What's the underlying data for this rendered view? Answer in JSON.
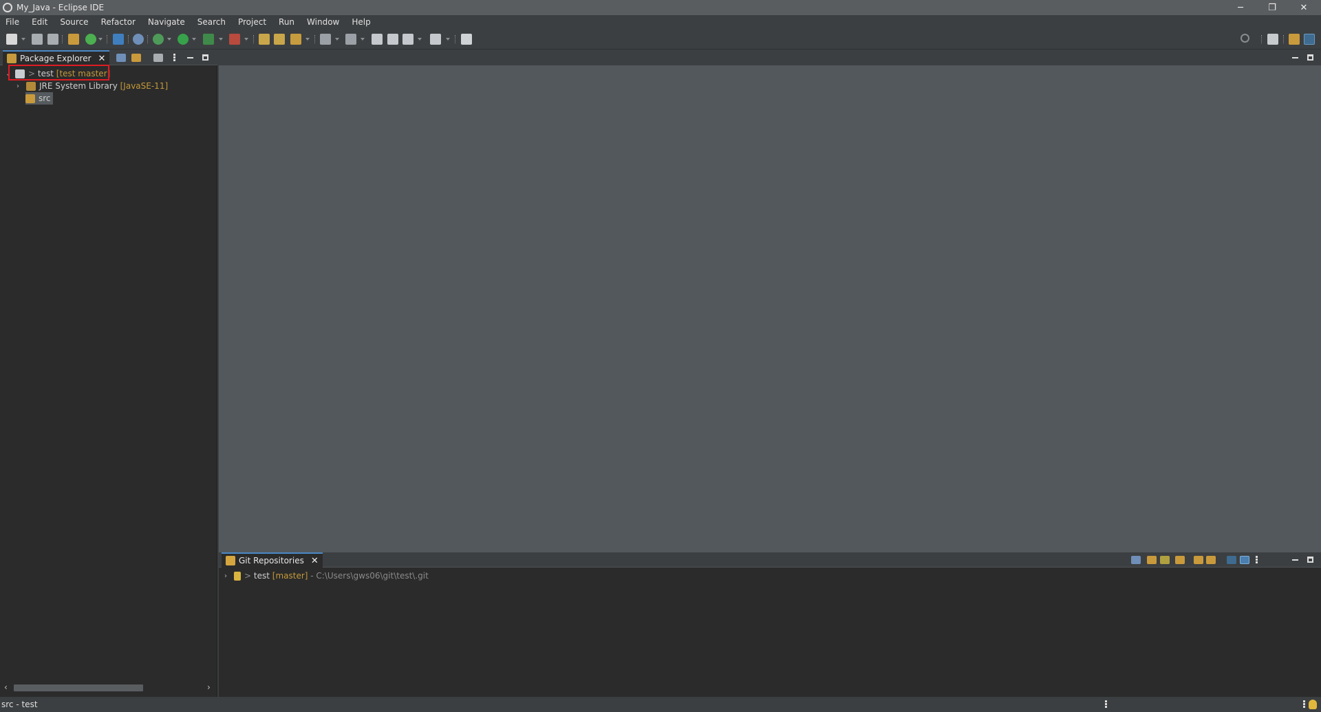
{
  "window": {
    "title": "My_Java - Eclipse IDE",
    "controls": [
      "minimize",
      "restore",
      "close"
    ]
  },
  "menubar": {
    "items": [
      "File",
      "Edit",
      "Source",
      "Refactor",
      "Navigate",
      "Search",
      "Project",
      "Run",
      "Window",
      "Help"
    ]
  },
  "toolbar": {
    "icons": [
      "new-icon",
      "save-icon",
      "save-all-icon",
      "new-java-project-icon",
      "new-java-class-icon",
      "terminal-icon",
      "skip-breakpoints-icon",
      "debug-icon",
      "run-icon",
      "coverage-icon",
      "external-tools-icon",
      "open-type-icon",
      "open-task-icon",
      "search-icon",
      "next-annotation-icon",
      "previous-annotation-icon",
      "last-edit-icon",
      "back-icon",
      "forward-icon",
      "pin-editor-icon"
    ],
    "right_icons": [
      "search-icon",
      "open-perspective-icon",
      "java-perspective-icon",
      "git-perspective-icon"
    ]
  },
  "package_explorer": {
    "tab_label": "Package Explorer",
    "tree": [
      {
        "prefix": ">",
        "name": "test",
        "decoration": "[test master]"
      },
      {
        "name": "JRE System Library",
        "decoration": "[JavaSE-11]"
      },
      {
        "name": "src"
      }
    ]
  },
  "git_repositories": {
    "tab_label": "Git Repositories",
    "repos": [
      {
        "prefix": ">",
        "name": "test",
        "branch": "[master]",
        "path": "- C:\\Users\\gws06\\git\\test\\.git"
      }
    ]
  },
  "status_bar": {
    "text": "src - test"
  },
  "colors": {
    "highlight_box": "#e01b24",
    "active_tab": "#4a88c7",
    "decoration": "#c49a3a"
  }
}
